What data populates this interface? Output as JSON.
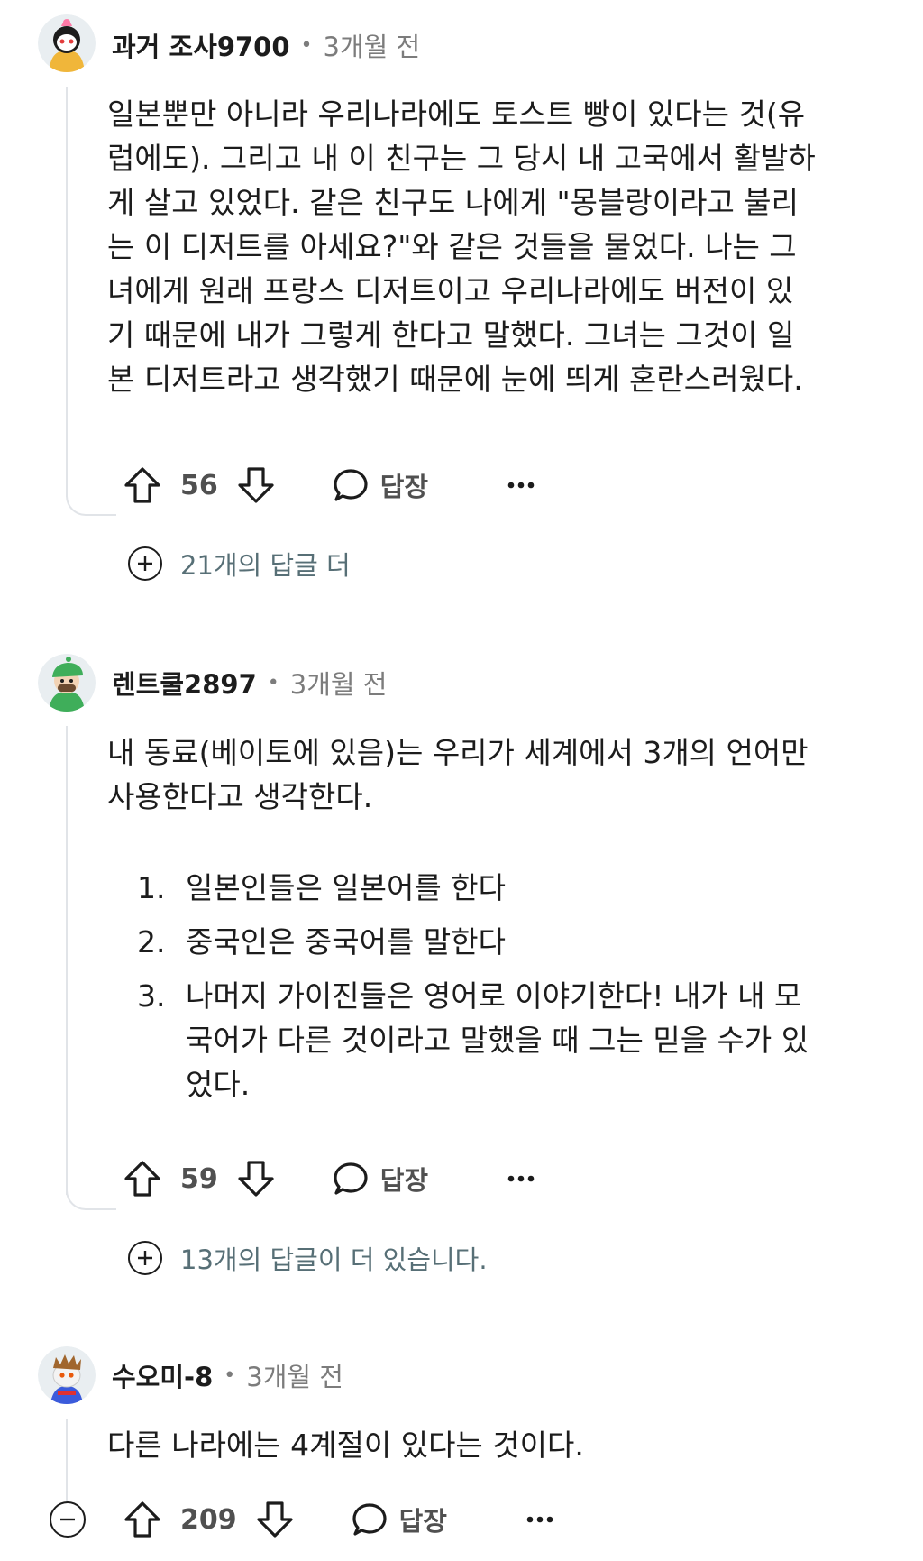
{
  "comments": [
    {
      "username": "과거 조사9700",
      "separator": "•",
      "time": "3개월 전",
      "body_lines": [
        "일본뿐만 아니라 우리나라에도 토스트 빵이 있다는 것(유",
        "럽에도). 그리고 내 이 친구는 그 당시 내 고국에서 활발하",
        "게 살고 있었다. 같은 친구도 나에게 \"몽블랑이라고 불리",
        "는 이 디저트를 아세요?\"와 같은 것들을 물었다. 나는 그",
        "녀에게 원래 프랑스 디저트이고 우리나라에도 버전이 있",
        "기 때문에 내가 그렇게 한다고 말했다. 그녀는 그것이 일",
        "본 디저트라고 생각했기 때문에 눈에 띄게 혼란스러웠다."
      ],
      "score": "56",
      "reply_label": "답장",
      "more_replies": "21개의 답글 더",
      "avatar_icon": "avatar-girl-icon"
    },
    {
      "username": "렌트쿨2897",
      "separator": "•",
      "time": "3개월 전",
      "body_lines": [
        "내 동료(베이토에 있음)는 우리가 세계에서 3개의 언어만",
        "사용한다고 생각한다."
      ],
      "list": [
        {
          "num": "1.",
          "lines": [
            "일본인들은 일본어를 한다"
          ]
        },
        {
          "num": "2.",
          "lines": [
            "중국인은 중국어를 말한다"
          ]
        },
        {
          "num": "3.",
          "lines": [
            "나머지 가이진들은 영어로 이야기한다! 내가 내 모",
            "국어가 다른 것이라고 말했을 때 그는 믿을 수가 있",
            "었다."
          ]
        }
      ],
      "score": "59",
      "reply_label": "답장",
      "more_replies": "13개의 답글이 더 있습니다.",
      "avatar_icon": "avatar-green-cap-icon"
    },
    {
      "username": "수오미-8",
      "separator": "•",
      "time": "3개월 전",
      "body_lines": [
        "다른 나라에는 4계절이 있다는 것이다."
      ],
      "score": "209",
      "reply_label": "답장",
      "avatar_icon": "avatar-snoo-icon"
    }
  ],
  "icons": {
    "upvote": "upvote-arrow-icon",
    "downvote": "downvote-arrow-icon",
    "reply": "speech-bubble-icon",
    "more": "ellipsis-icon",
    "expand": "plus-circle-icon",
    "collapse": "minus-circle-icon"
  },
  "colors": {
    "text": "#1c1c1c",
    "muted": "#7c7c7c",
    "thread_line": "#e1e4e8",
    "link": "#576f76"
  }
}
